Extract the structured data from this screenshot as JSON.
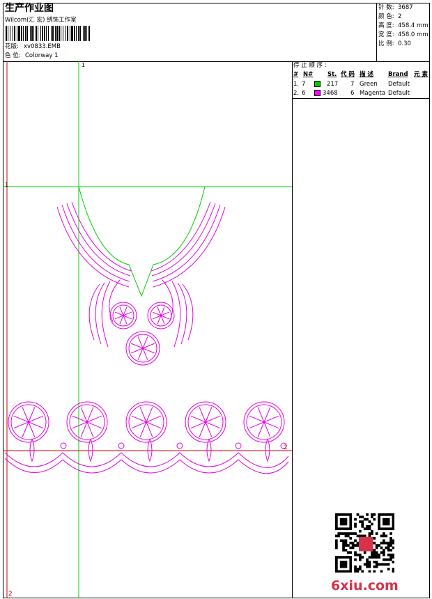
{
  "header": {
    "title": "生产作业图",
    "company": "Wilcom(汇 宏) 绣饰工作室",
    "design_label": "花版:",
    "design_value": "xv0833.EMB",
    "colorway_label": "色 位:",
    "colorway_value": "Colorway 1"
  },
  "stats": {
    "stitches_label": "针 数:",
    "stitches_value": "3687",
    "colors_label": "颜 色:",
    "colors_value": "2",
    "height_label": "高 度:",
    "height_value": "458.4 mm",
    "width_label": "宽 度:",
    "width_value": "458.0 mm",
    "scale_label": "比 例:",
    "scale_value": "0.30"
  },
  "stop_sequence": {
    "heading": "停 止 顺 序 :",
    "columns": [
      "#",
      "N#",
      "St.",
      "代 码",
      "描 述",
      "Brand",
      "元 素"
    ],
    "rows": [
      {
        "index": "1.",
        "needle": "7",
        "color": "#00cc00",
        "stitches": "217",
        "code": "7",
        "description": "Green",
        "brand": "Default"
      },
      {
        "index": "2.",
        "needle": "6",
        "color": "#ff00ff",
        "stitches": "3468",
        "code": "6",
        "description": "Magenta",
        "brand": "Default"
      }
    ]
  },
  "markers": {
    "top_1": "1",
    "left_1": "1",
    "right_2": "2",
    "bottom_2": "2"
  },
  "watermark": "6xiu.com",
  "colors": {
    "green": "#00cc00",
    "magenta": "#e600e6",
    "red": "#cc0000"
  }
}
